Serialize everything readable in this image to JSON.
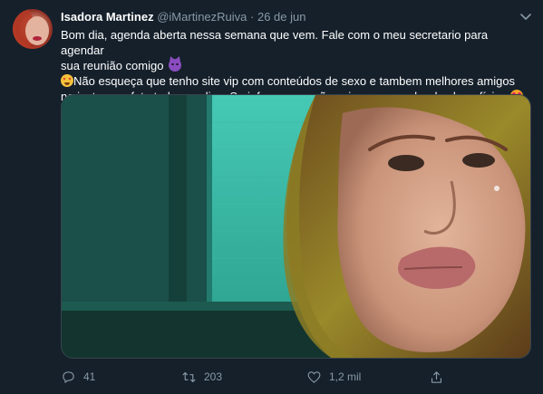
{
  "tweet": {
    "author_name": "Isadora Martinez",
    "handle": "@iMartinezRuiva",
    "separator": "·",
    "date": "26 de jun",
    "line1": "Bom dia, agenda aberta nessa semana que vem. Fale com o meu secretario para agendar",
    "line2": "sua reunião comigo",
    "line3": "Não esqueça que tenho site vip com conteúdos de sexo e tambem melhores amigos",
    "line4": "no insta com foto todos os dias. Se informe que não vai se arrepender dos benefícios",
    "emojis": [
      "smiling-imp",
      "star-struck",
      "heart-eyes-cat"
    ]
  },
  "actions": {
    "reply_count": "41",
    "retweet_count": "203",
    "like_count": "1,2 mil"
  },
  "colors": {
    "background": "#15202b",
    "text": "#ffffff",
    "muted": "#8899a6",
    "border": "#38444d"
  }
}
